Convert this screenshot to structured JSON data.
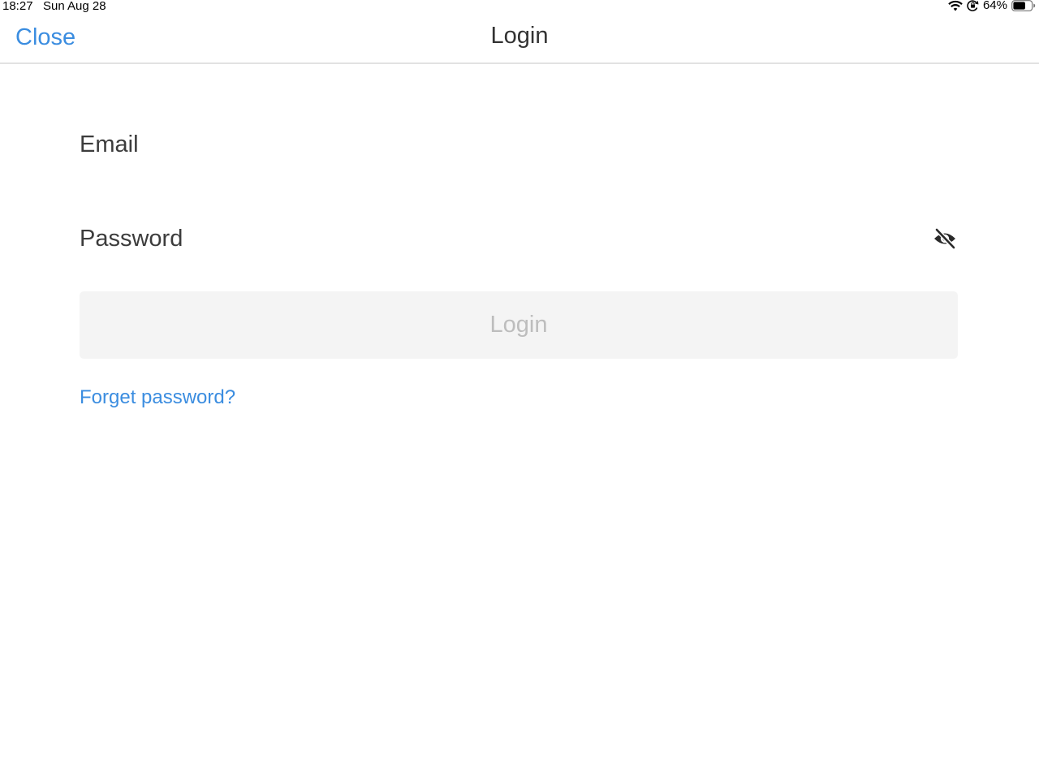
{
  "status_bar": {
    "time": "18:27",
    "date": "Sun Aug 28",
    "battery_percent": "64%",
    "icons": [
      "wifi-icon",
      "orientation-lock-icon",
      "battery-icon"
    ]
  },
  "nav": {
    "close_label": "Close",
    "title": "Login"
  },
  "form": {
    "email_placeholder": "Email",
    "email_value": "",
    "password_placeholder": "Password",
    "password_value": "",
    "password_toggle_icon": "eye-slash-icon",
    "login_label": "Login",
    "forget_password_label": "Forget password?"
  },
  "colors": {
    "accent": "#3b8de0",
    "button_bg": "#f4f4f4",
    "button_text_disabled": "#bdbdbd",
    "divider": "#e2e2e2"
  }
}
